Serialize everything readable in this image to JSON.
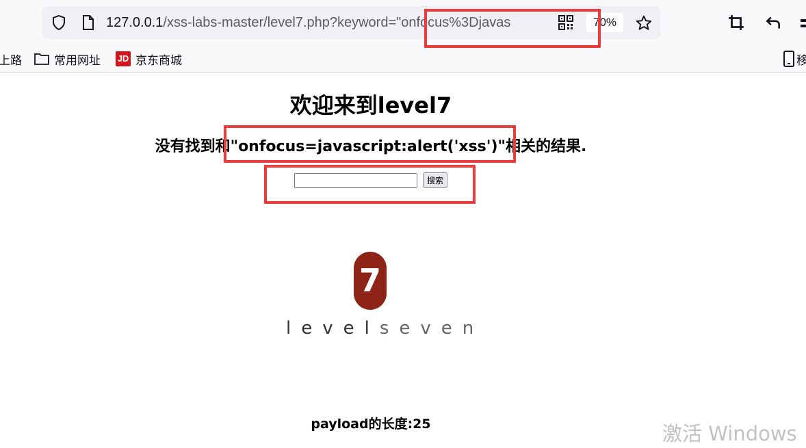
{
  "browser": {
    "url": {
      "host": "127.0.0.1",
      "path": "/xss-labs-master/level7.php?keyword=",
      "query_value": "\"onfocus%3Djavas"
    },
    "zoom": "70%",
    "bookmarks": [
      {
        "label": "上路",
        "icon": "none"
      },
      {
        "label": "常用网址",
        "icon": "folder-icon"
      },
      {
        "label": "京东商城",
        "icon": "jd-logo-icon"
      }
    ],
    "mobile_bookmarks_label": "移",
    "icons": [
      "shield-icon",
      "page-icon",
      "qr-code-icon",
      "star-icon",
      "crop-icon",
      "undo-icon"
    ]
  },
  "page": {
    "title": "欢迎来到level7",
    "result_prefix": "没有找到和",
    "result_keyword": "\"onfocus=javascript:alert('xss')\"",
    "result_suffix": "相关的结果.",
    "search_value": "",
    "search_button": "搜索",
    "logo": {
      "badge_digit": "7",
      "word_level": "level",
      "word_seven": "seven",
      "badge_color": "#8e2418"
    },
    "payload_length_label": "payload的长度:25"
  },
  "overlay": {
    "highlight_color": "#ef3b3b",
    "watermark": "激活 Windows"
  }
}
